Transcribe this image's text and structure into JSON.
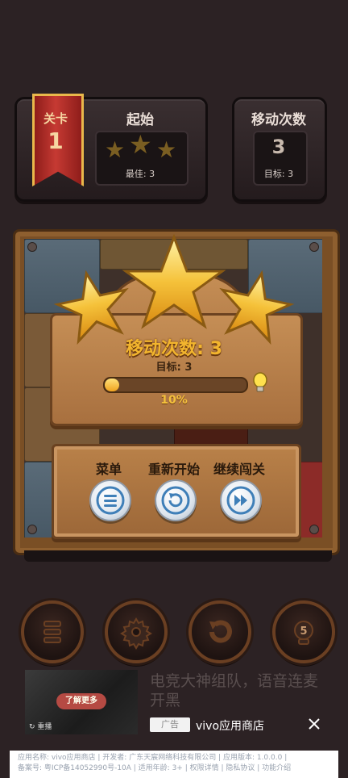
{
  "hud": {
    "level_label": "关卡",
    "level_number": "1",
    "start_label": "起始",
    "best_label": "最佳: 3",
    "moves_label": "移动次数",
    "moves_value": "3",
    "target_label": "目标: 3",
    "stars_earned": 3
  },
  "result": {
    "moves_text": "移动次数: 3",
    "target_text": "目标: 3",
    "progress_pct": 10,
    "progress_label": "10%",
    "stars_earned": 3
  },
  "menu": {
    "menu_label": "菜单",
    "restart_label": "重新开始",
    "continue_label": "继续闯关"
  },
  "controls": {
    "icons": [
      "list-icon",
      "gear-icon",
      "undo-icon",
      "hint-bulb-icon"
    ],
    "hint_count": "5"
  },
  "ad": {
    "learn_more": "了解更多",
    "replay": "重播",
    "title": "电竞大神组队，语音连麦开黑",
    "badge": "广告",
    "store": "vivo应用商店"
  },
  "footer": {
    "line1": "应用名称: vivo应用商店 | 开发者: 广东天宸网络科技有限公司 | 应用版本: 1.0.0.0 |",
    "line2": "备案号: 粤ICP备14052990号-10A | 适用年龄: 3+ | 权限详情 | 隐私协议 | 功能介绍"
  },
  "colors": {
    "accent_gold": "#f2b52e",
    "ribbon_red": "#c63a33",
    "wood": "#c58e55"
  }
}
